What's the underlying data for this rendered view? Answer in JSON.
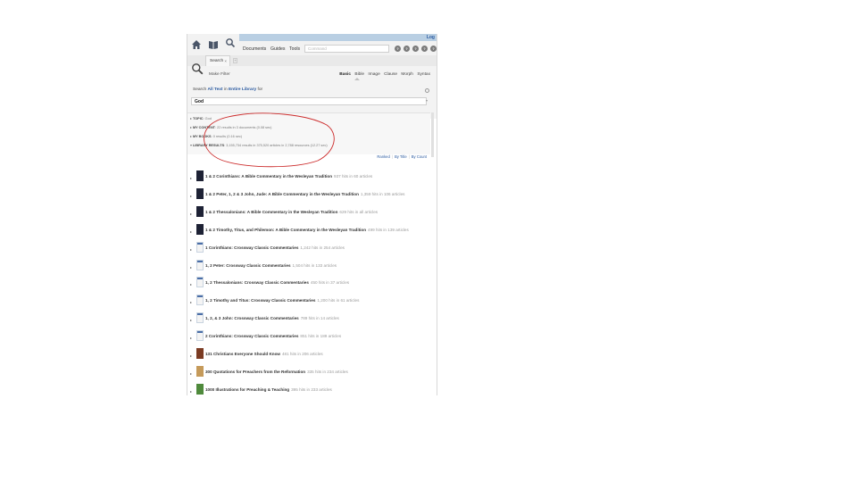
{
  "window": {
    "login_label": "Log"
  },
  "toolbar": {
    "home_icon": "home-icon",
    "library_icon": "book-icon",
    "search_icon": "search-icon",
    "nav": [
      "Documents",
      "Guides",
      "Tools"
    ],
    "command_placeholder": "Command",
    "circle_buttons": [
      "?",
      "?",
      "?",
      "?",
      "?"
    ]
  },
  "tabs": {
    "search_label": "Search",
    "close": "×",
    "add": "+"
  },
  "panel": {
    "make_filter": "Make Filter",
    "kinds": [
      "Basic",
      "Bible",
      "Image",
      "Clause",
      "Morph",
      "Syntax"
    ],
    "selected_kind": "Basic",
    "scope_prefix": "Search",
    "scope_all_text": "All Text",
    "scope_in": "in",
    "scope_library": "Entire Library",
    "scope_for": "for",
    "query": "God"
  },
  "results_header": [
    {
      "label": "TOPIC",
      "text": "God"
    },
    {
      "label": "MY CONTENT",
      "text": "22 results in 3 documents (0.08 sec)"
    },
    {
      "label": "MY BOOKS",
      "text": "0 results (0.16 sec)"
    },
    {
      "label": "LIBRARY RESULTS",
      "text": "3,155,734 results in 375,520 articles in 2,788 resources (12.27 sec)"
    }
  ],
  "sort": [
    "Ranked",
    "By Title",
    "By Count"
  ],
  "results": [
    {
      "title": "1 & 2 Corinthians: A Bible Commentary in the Wesleyan Tradition",
      "hits": "937 hits in 60 articles",
      "cover": "dark"
    },
    {
      "title": "1 & 2 Peter, 1, 2 & 3 John, Jude: A Bible Commentary in the Wesleyan Tradition",
      "hits": "1,359 hits in 106 articles",
      "cover": "dark"
    },
    {
      "title": "1 & 2 Thessalonians: A Bible Commentary in the Wesleyan Tradition",
      "hits": "629 hits in all articles",
      "cover": "dark"
    },
    {
      "title": "1 & 2 Timothy, Titus, and Philemon: A Bible Commentary in the Wesleyan Tradition",
      "hits": "499 hits in 139 articles",
      "cover": "dark"
    },
    {
      "title": "1 Corinthians: Crossway Classic Commentaries",
      "hits": "1,242 hits in 254 articles",
      "cover": "crossway"
    },
    {
      "title": "1, 2 Peter: Crossway Classic Commentaries",
      "hits": "1,504 hits in 133 articles",
      "cover": "crossway"
    },
    {
      "title": "1, 2 Thessalonians: Crossway Classic Commentaries",
      "hits": "450 hits in 37 articles",
      "cover": "crossway"
    },
    {
      "title": "1, 2 Timothy and Titus: Crossway Classic Commentaries",
      "hits": "1,200 hits in 61 articles",
      "cover": "crossway"
    },
    {
      "title": "1, 2, & 3 John: Crossway Classic Commentaries",
      "hits": "789 hits in 14 articles",
      "cover": "crossway"
    },
    {
      "title": "2 Corinthians: Crossway Classic Commentaries",
      "hits": "851 hits in 189 articles",
      "cover": "crossway"
    },
    {
      "title": "131 Christians Everyone Should Know",
      "hits": "481 hits in 206 articles",
      "cover": "brown"
    },
    {
      "title": "300 Quotations for Preachers from the Reformation",
      "hits": "335 hits in 234 articles",
      "cover": "tan"
    },
    {
      "title": "1000 Illustrations for Preaching & Teaching",
      "hits": "395 hits in 233 articles",
      "cover": "green"
    }
  ]
}
